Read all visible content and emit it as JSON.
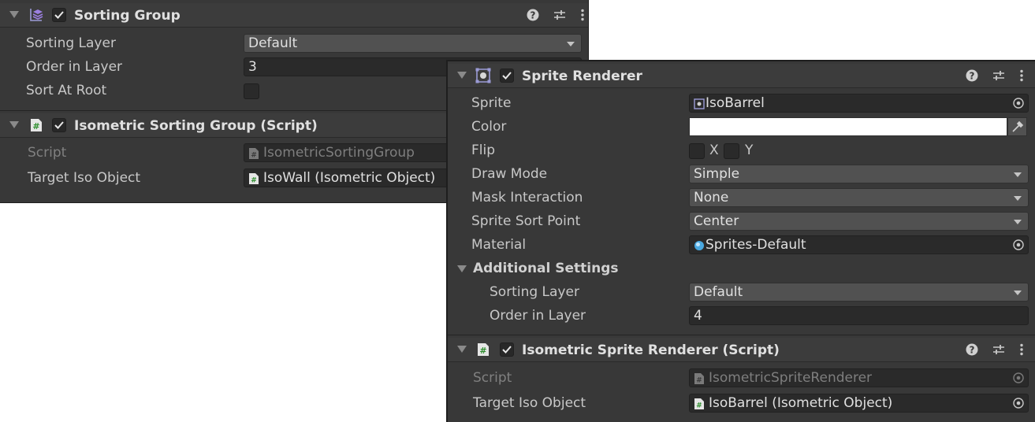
{
  "sorting_group": {
    "title": "Sorting Group",
    "fields": {
      "sorting_layer_label": "Sorting Layer",
      "sorting_layer_value": "Default",
      "order_label": "Order in Layer",
      "order_value": "3",
      "sort_root_label": "Sort At Root"
    }
  },
  "iso_sorting_group": {
    "title": "Isometric Sorting Group (Script)",
    "script_label": "Script",
    "script_value": "IsometricSortingGroup",
    "target_label": "Target Iso Object",
    "target_value": "IsoWall (Isometric Object)"
  },
  "sprite_renderer": {
    "title": "Sprite Renderer",
    "sprite_label": "Sprite",
    "sprite_value": "IsoBarrel",
    "color_label": "Color",
    "color_value": "#ffffff",
    "flip_label": "Flip",
    "flip_x": "X",
    "flip_y": "Y",
    "draw_mode_label": "Draw Mode",
    "draw_mode_value": "Simple",
    "mask_label": "Mask Interaction",
    "mask_value": "None",
    "sort_point_label": "Sprite Sort Point",
    "sort_point_value": "Center",
    "material_label": "Material",
    "material_value": "Sprites-Default",
    "additional_label": "Additional Settings",
    "add_sorting_layer_label": "Sorting Layer",
    "add_sorting_layer_value": "Default",
    "add_order_label": "Order in Layer",
    "add_order_value": "4"
  },
  "iso_sprite_renderer": {
    "title": "Isometric Sprite Renderer (Script)",
    "script_label": "Script",
    "script_value": "IsometricSpriteRenderer",
    "target_label": "Target Iso Object",
    "target_value": "IsoBarrel (Isometric Object)"
  },
  "icons": {
    "help": "help-icon",
    "presets": "presets-icon",
    "more": "more-icon"
  }
}
